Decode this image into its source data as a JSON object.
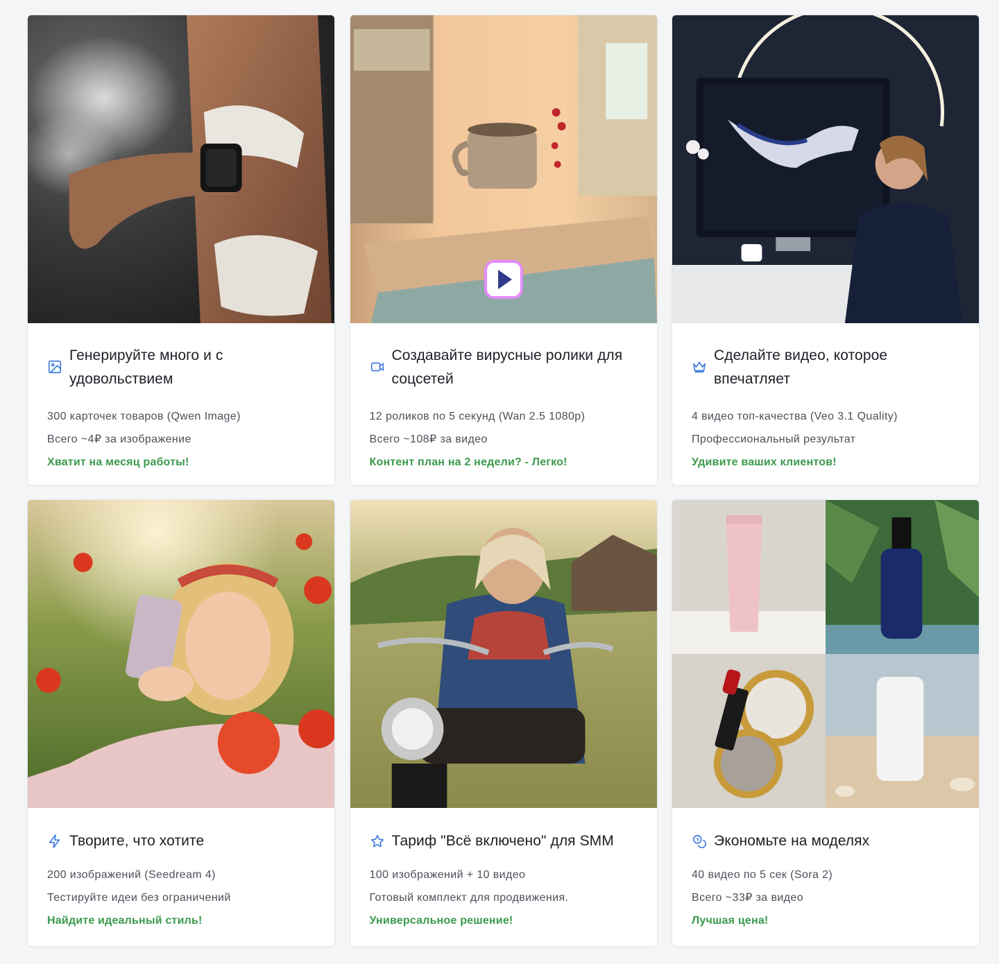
{
  "colors": {
    "accent_green": "#3a9a4c",
    "icon_blue": "#3f7be0",
    "title_text": "#1b1e24",
    "body_text": "#4a4f58",
    "page_bg": "#f4f5f7"
  },
  "cards": [
    {
      "icon": "image-icon",
      "title": "Генерируйте много и с удовольствием",
      "line1": "300 карточек товаров (Qwen Image)",
      "line2": "Всего ~4₽ за изображение",
      "accent": "Хватит на месяц работы!",
      "photo": "woman-with-smartwatch-photo"
    },
    {
      "icon": "video-camera-icon",
      "title": "Создавайте вирусные ролики для соцсетей",
      "line1": "12 роликов по 5 секунд (Wan 2.5 1080p)",
      "line2": "Всего ~108₽ за видео",
      "accent": "Контент план на 2 недели? - Легко!",
      "photo": "kitchen-floating-mug-photo"
    },
    {
      "icon": "crown-icon",
      "title": "Сделайте видео, которое впечатляет",
      "line1": "4 видео топ-качества (Veo 3.1 Quality)",
      "line2": "Профессиональный результат",
      "accent": "Удивите ваших клиентов!",
      "photo": "woman-at-monitor-scarf-photo"
    },
    {
      "icon": "lightning-icon",
      "title": "Творите, что хотите",
      "line1": "200 изображений (Seedream 4)",
      "line2": "Тестируйте идеи без ограничений",
      "accent": "Найдите идеальный стиль!",
      "photo": "girl-in-poppy-field-photo"
    },
    {
      "icon": "star-icon",
      "title": "Тариф \"Всё включено\" для SMM",
      "line1": "100 изображений + 10 видео",
      "line2": "Готовый комплект для продвижения.",
      "accent": "Универсальное решение!",
      "photo": "grandma-on-motorcycle-photo"
    },
    {
      "icon": "coins-icon",
      "title": "Экономьте на моделях",
      "line1": "40 видео по 5 сек (Sora 2)",
      "line2": "Всего ~33₽ за видео",
      "accent": "Лучшая цена!",
      "photo": "cosmetics-collage-photo"
    }
  ]
}
